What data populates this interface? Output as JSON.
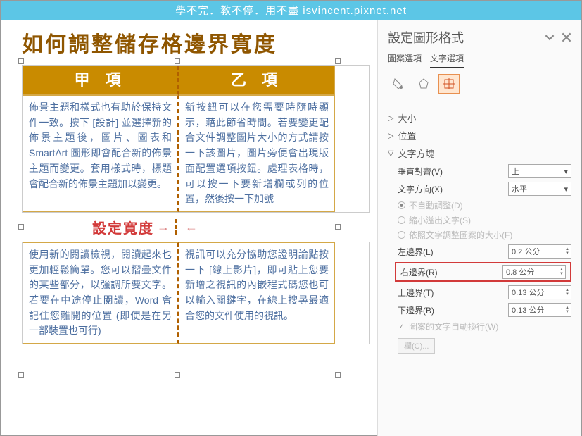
{
  "banner": "學不完．教不停．用不盡 isvincent.pixnet.net",
  "title": "如何調整儲存格邊界寬度",
  "table": {
    "header1": "甲 項",
    "header2": "乙 項",
    "r1c1": "佈景主題和樣式也有助於保持文件一致。按下 [設計] 並選擇新的佈景主題後，圖片、圖表和 SmartArt 圖形即會配合新的佈景主題而變更。套用樣式時，標題會配合新的佈景主題加以變更。",
    "r1c2": "新按鈕可以在您需要時隨時顯示，藉此節省時間。若要變更配合文件調整圖片大小的方式請按一下該圖片，圖片旁便會出現版面配置選項按鈕。處理表格時，可以按一下要新增欄或列的位置，然後按一下加號",
    "r2c1": "使用新的閱讀檢視，閱讀起來也更加輕鬆簡單。您可以摺疊文件的某些部分，以強調所要文字。若要在中途停止閱讀，Word 會記住您離開的位置 (即使是在另一部裝置也可行)",
    "r2c2": "視訊可以充分協助您證明論點按一下 [線上影片]，即可貼上您要新增之視訊的內嵌程式碼您也可以輸入關鍵字，在線上搜尋最適合您的文件使用的視訊。"
  },
  "annotation": "設定寬度",
  "panel": {
    "title": "設定圖形格式",
    "tab_shape": "圖案選項",
    "tab_text": "文字選項",
    "sec_size": "大小",
    "sec_position": "位置",
    "sec_textbox": "文字方塊",
    "valign_label": "垂直對齊(V)",
    "valign_value": "上",
    "textdir_label": "文字方向(X)",
    "textdir_value": "水平",
    "radio1": "不自動調整(D)",
    "radio2": "縮小溢出文字(S)",
    "radio3": "依照文字調整圖案的大小(F)",
    "margin_left_label": "左邊界(L)",
    "margin_left_value": "0.2 公分",
    "margin_right_label": "右邊界(R)",
    "margin_right_value": "0.8 公分",
    "margin_top_label": "上邊界(T)",
    "margin_top_value": "0.13 公分",
    "margin_bottom_label": "下邊界(B)",
    "margin_bottom_value": "0.13 公分",
    "wrap_label": "圖案的文字自動換行(W)",
    "columns_btn": "欄(C)..."
  }
}
